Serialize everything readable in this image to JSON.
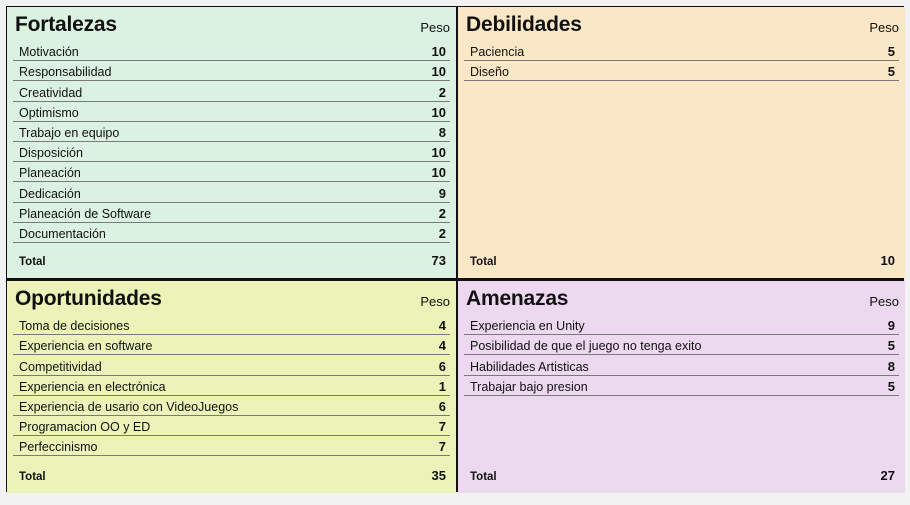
{
  "fortalezas": {
    "title": "Fortalezas",
    "weight_header": "Peso",
    "items": [
      {
        "name": "Motivación",
        "value": "10"
      },
      {
        "name": "Responsabilidad",
        "value": "10"
      },
      {
        "name": "Creatividad",
        "value": "2"
      },
      {
        "name": "Optimismo",
        "value": "10"
      },
      {
        "name": "Trabajo en equipo",
        "value": "8"
      },
      {
        "name": "Disposición",
        "value": "10"
      },
      {
        "name": "Planeación",
        "value": "10"
      },
      {
        "name": "Dedicación",
        "value": "9"
      },
      {
        "name": "Planeación de Software",
        "value": "2"
      },
      {
        "name": "Documentación",
        "value": "2"
      }
    ],
    "total_label": "Total",
    "total_value": "73"
  },
  "debilidades": {
    "title": "Debilidades",
    "weight_header": "Peso",
    "items": [
      {
        "name": "Paciencia",
        "value": "5"
      },
      {
        "name": "Diseño",
        "value": "5"
      }
    ],
    "total_label": "Total",
    "total_value": "10"
  },
  "oportunidades": {
    "title": "Oportunidades",
    "weight_header": "Peso",
    "items": [
      {
        "name": "Toma de decisiones",
        "value": "4"
      },
      {
        "name": "Experiencia en software",
        "value": "4"
      },
      {
        "name": "Competitividad",
        "value": "6"
      },
      {
        "name": "Experiencia en electrónica",
        "value": "1"
      },
      {
        "name": "Experiencia de usario con VideoJuegos",
        "value": "6"
      },
      {
        "name": "Programacion OO y ED",
        "value": "7"
      },
      {
        "name": "Perfeccinismo",
        "value": "7"
      }
    ],
    "total_label": "Total",
    "total_value": "35"
  },
  "amenazas": {
    "title": "Amenazas",
    "weight_header": "Peso",
    "items": [
      {
        "name": "Experiencia en Unity",
        "value": "9"
      },
      {
        "name": "Posibilidad de que el juego no tenga exito",
        "value": "5"
      },
      {
        "name": "Habilidades Artisticas",
        "value": "8"
      },
      {
        "name": "Trabajar bajo presion",
        "value": "5"
      }
    ],
    "total_label": "Total",
    "total_value": "27"
  },
  "colors": {
    "fortalezas_bg": "#dbf1e1",
    "debilidades_bg": "#fae7c6",
    "oportunidades_bg": "#ebf3b8",
    "amenazas_bg": "#ecd9ef"
  }
}
